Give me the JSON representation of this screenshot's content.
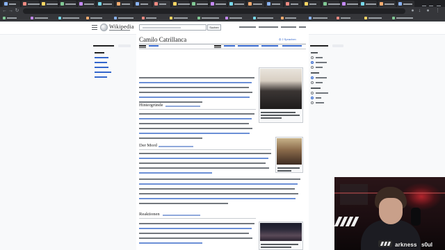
{
  "browser": {
    "url": "",
    "tab_count": 22,
    "colors": {
      "chrome": "#202124",
      "toolbar": "#35363a",
      "tab_active": "#35363a"
    }
  },
  "wikipedia": {
    "logo_text": "Wikipedia",
    "search_button": "Suchen",
    "article_title": "Camilo Catrillanca",
    "lang_button": "2 Sprachen",
    "sections": [
      {
        "heading": "Hintergründe"
      },
      {
        "heading": "Der Mord"
      },
      {
        "heading": "Reaktionen"
      }
    ],
    "icons": {
      "menu": "hamburger-icon",
      "logo": "wikipedia-globe-icon",
      "language": "translate-icon"
    },
    "colors": {
      "link": "#3366cc",
      "text": "#202122",
      "border": "#a2a9b1",
      "background": "#ffffff"
    }
  },
  "stream": {
    "streamer_name": "arkness",
    "streamer_name_2": "s0ul",
    "colors": {
      "accent": "#b3242c"
    }
  }
}
